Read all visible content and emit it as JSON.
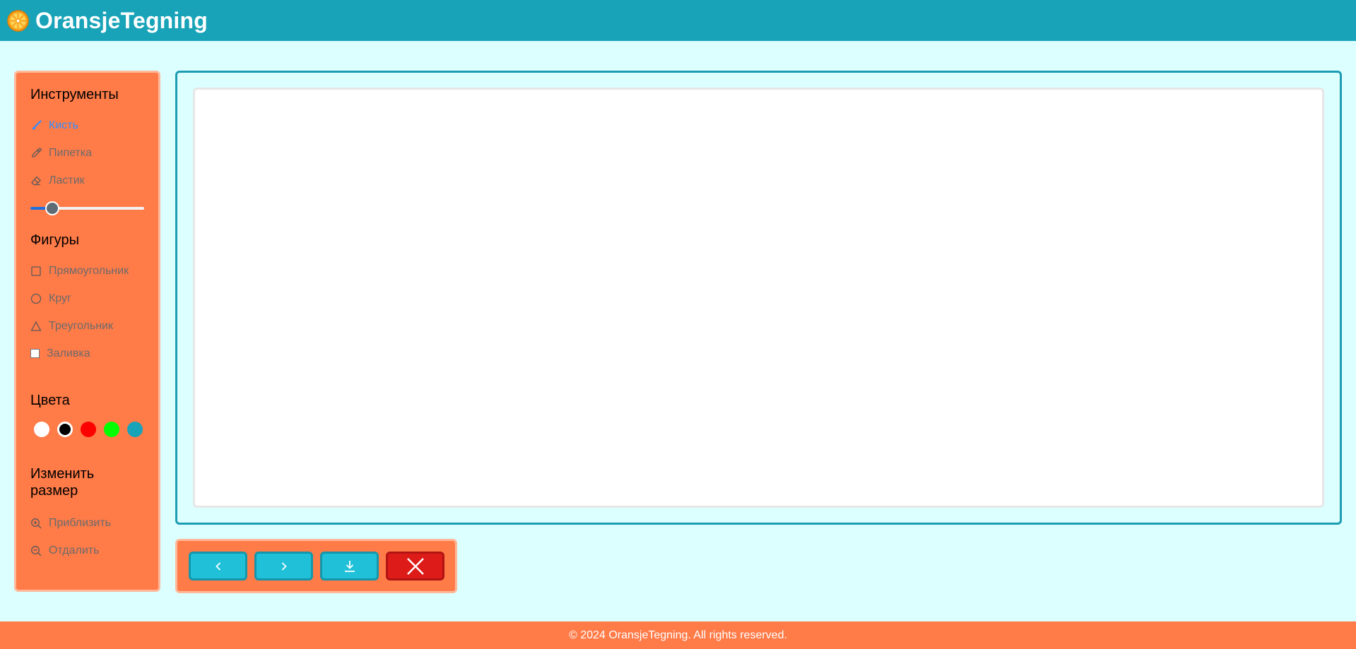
{
  "header": {
    "title": "OransjeTegning",
    "logo_icon": "orange-slice-icon"
  },
  "sidebar": {
    "tools": {
      "title": "Инструменты",
      "items": [
        {
          "label": "Кисть",
          "icon": "brush-icon",
          "active": true
        },
        {
          "label": "Пипетка",
          "icon": "eyedropper-icon",
          "active": false
        },
        {
          "label": "Ластик",
          "icon": "eraser-icon",
          "active": false
        }
      ],
      "brush_size_fraction": 0.19
    },
    "shapes": {
      "title": "Фигуры",
      "items": [
        {
          "label": "Прямоугольник",
          "icon": "square-icon"
        },
        {
          "label": "Круг",
          "icon": "circle-icon"
        },
        {
          "label": "Треугольник",
          "icon": "triangle-icon"
        }
      ],
      "fill_label": "Заливка",
      "fill_checked": false
    },
    "colors": {
      "title": "Цвета",
      "swatches": [
        "#ffffff",
        "#000000",
        "#ff0000",
        "#00ff00",
        "#18a3b8"
      ],
      "selected": "#000000"
    },
    "resize": {
      "title": "Изменить размер",
      "items": [
        {
          "label": "Приблизить",
          "icon": "zoom-in-icon"
        },
        {
          "label": "Отдалить",
          "icon": "zoom-out-icon"
        }
      ]
    }
  },
  "toolbar": {
    "buttons": [
      {
        "icon": "chevron-left-icon"
      },
      {
        "icon": "chevron-right-icon"
      },
      {
        "icon": "download-icon"
      },
      {
        "icon": "close-icon"
      }
    ]
  },
  "footer": {
    "text": "© 2024 OransjeTegning. All rights reserved."
  },
  "colors": {
    "header": "#18a3b8",
    "panel": "#ff7b48",
    "background": "#dcffff",
    "button": "#1fc0d8",
    "danger": "#dd1c1a",
    "active_tool": "#2f8fff"
  }
}
